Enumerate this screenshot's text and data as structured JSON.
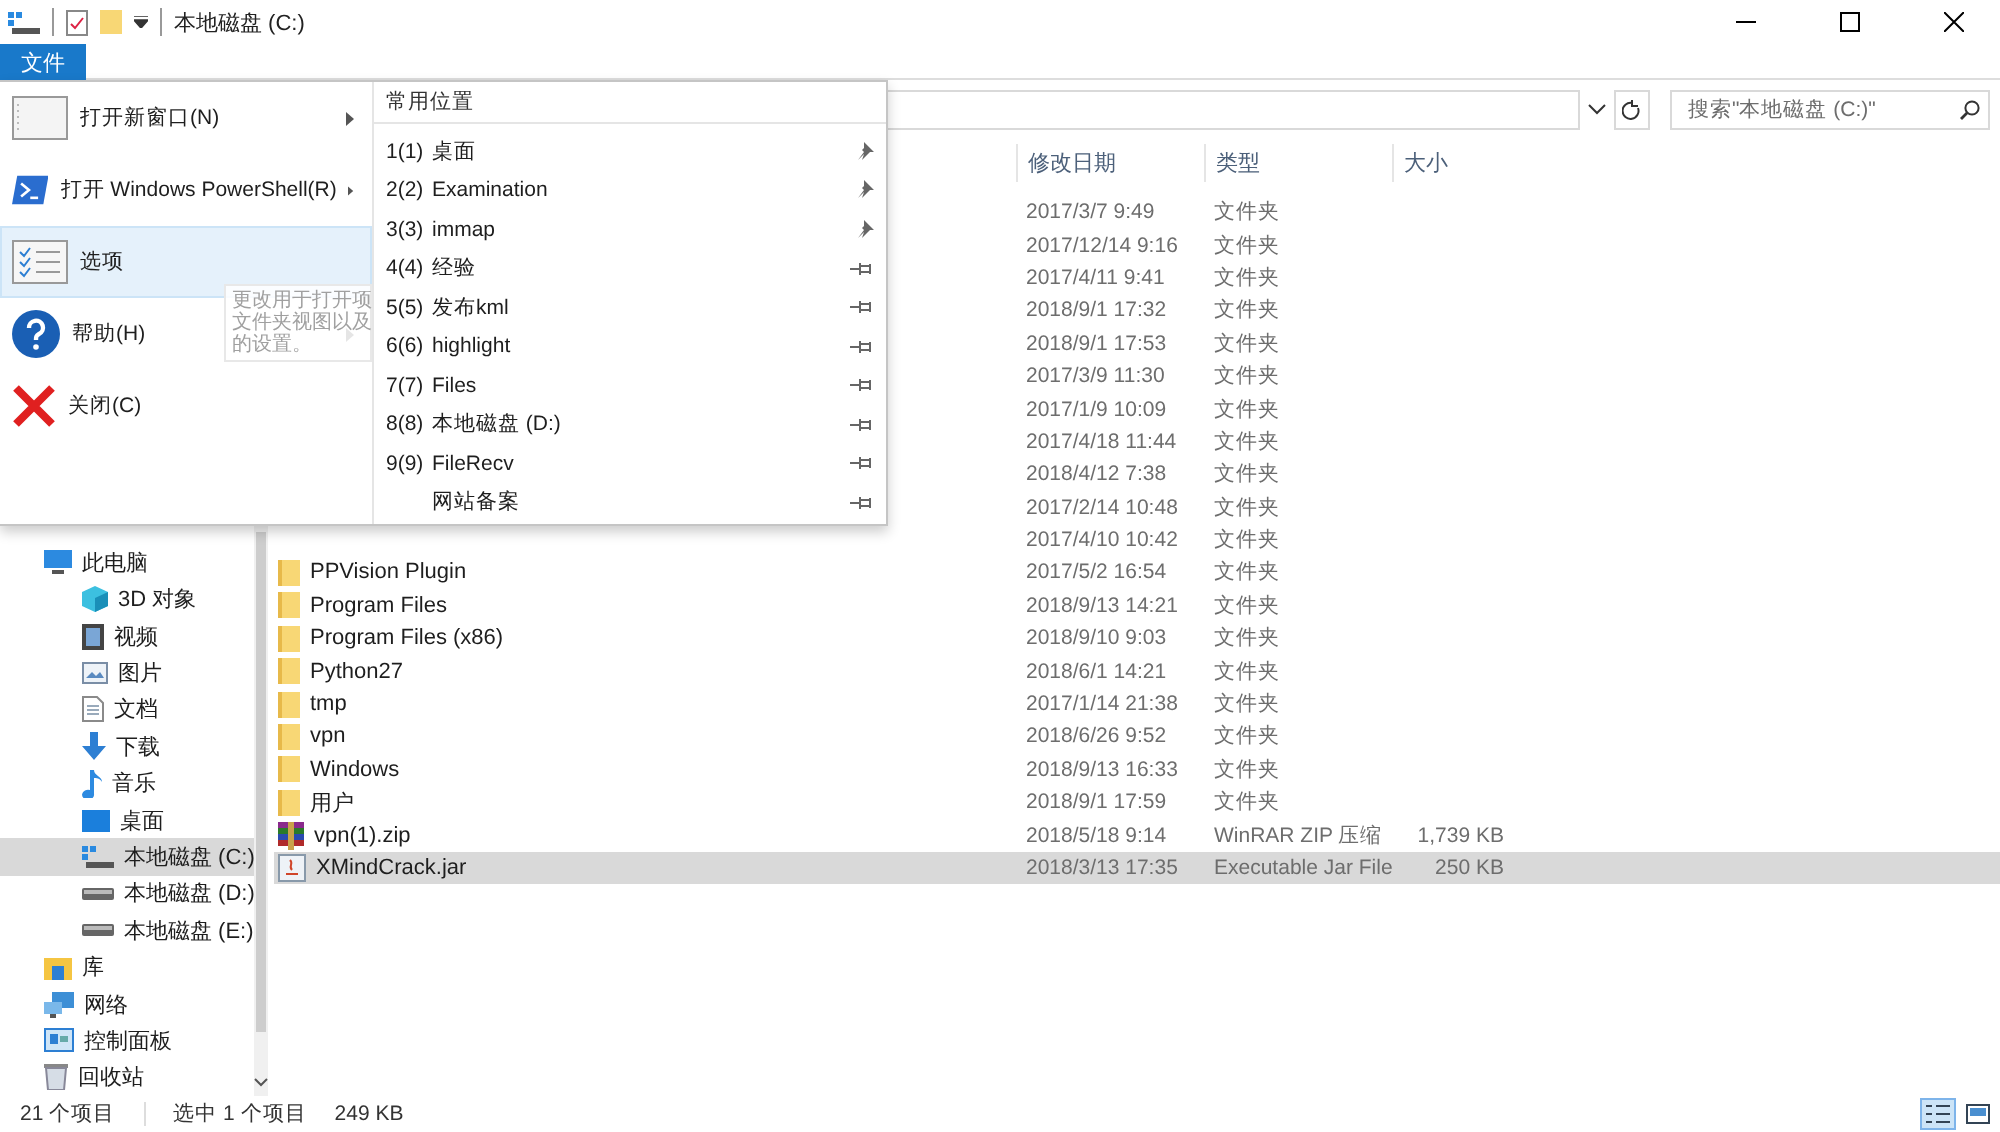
{
  "window": {
    "title": "本地磁盘 (C:)"
  },
  "file_tab": {
    "label": "文件",
    "selected": true
  },
  "file_menu": {
    "commands": [
      {
        "kind": "new-window",
        "label": "打开新窗口(N)",
        "has_submenu": true,
        "selected": false
      },
      {
        "kind": "powershell",
        "label": "打开 Windows PowerShell(R)",
        "has_submenu": true,
        "selected": false
      },
      {
        "kind": "options",
        "label": "选项",
        "has_submenu": false,
        "selected": true
      },
      {
        "kind": "help",
        "label": "帮助(H)",
        "has_submenu": true,
        "selected": false
      },
      {
        "kind": "close",
        "label": "关闭(C)",
        "has_submenu": false,
        "selected": false
      }
    ],
    "tooltip": {
      "lines": [
        "更改用于打开项",
        "文件夹视图以及",
        "的设置。"
      ]
    },
    "frequent_places": {
      "title": "常用位置",
      "items": [
        {
          "number": "1(1)",
          "name": "桌面",
          "pinned": true
        },
        {
          "number": "2(2)",
          "name": "Examination",
          "pinned": true
        },
        {
          "number": "3(3)",
          "name": "immap",
          "pinned": true
        },
        {
          "number": "4(4)",
          "name": "经验",
          "pinned": false
        },
        {
          "number": "5(5)",
          "name": "发布kml",
          "pinned": false
        },
        {
          "number": "6(6)",
          "name": "highlight",
          "pinned": false
        },
        {
          "number": "7(7)",
          "name": "Files",
          "pinned": false
        },
        {
          "number": "8(8)",
          "name": "本地磁盘 (D:)",
          "pinned": false
        },
        {
          "number": "9(9)",
          "name": "FileRecv",
          "pinned": false
        },
        {
          "name": "网站备案",
          "pinned": false
        }
      ]
    }
  },
  "search": {
    "placeholder": "搜索\"本地磁盘 (C:)\""
  },
  "navigation": [
    {
      "kind": "computer",
      "label": "此电脑",
      "selected": false,
      "children": [
        {
          "kind": "objects",
          "label": "3D 对象",
          "selected": false
        },
        {
          "kind": "video",
          "label": "视频",
          "selected": false
        },
        {
          "kind": "pictures",
          "label": "图片",
          "selected": false
        },
        {
          "kind": "documents",
          "label": "文档",
          "selected": false
        },
        {
          "kind": "downloads",
          "label": "下载",
          "selected": false
        },
        {
          "kind": "music",
          "label": "音乐",
          "selected": false
        },
        {
          "kind": "desktop",
          "label": "桌面",
          "selected": false
        },
        {
          "kind": "system-drive",
          "label": "本地磁盘 (C:)",
          "selected": true
        },
        {
          "kind": "drive",
          "label": "本地磁盘 (D:)",
          "selected": false
        },
        {
          "kind": "drive",
          "label": "本地磁盘 (E:)",
          "selected": false
        }
      ]
    },
    {
      "kind": "library",
      "label": "库",
      "selected": false
    },
    {
      "kind": "network",
      "label": "网络",
      "selected": false
    },
    {
      "kind": "control-panel",
      "label": "控制面板",
      "selected": false
    },
    {
      "kind": "recycle-bin",
      "label": "回收站",
      "selected": false
    }
  ],
  "files": {
    "columns": [
      "修改日期",
      "类型",
      "大小"
    ],
    "rows": [
      {
        "date": "2017/3/7 9:49",
        "type": "文件夹",
        "selected": false
      },
      {
        "date": "2017/12/14 9:16",
        "type": "文件夹",
        "selected": false
      },
      {
        "date": "2017/4/11 9:41",
        "type": "文件夹",
        "selected": false
      },
      {
        "date": "2018/9/1 17:32",
        "type": "文件夹",
        "selected": false
      },
      {
        "date": "2018/9/1 17:53",
        "type": "文件夹",
        "selected": false
      },
      {
        "date": "2017/3/9 11:30",
        "type": "文件夹",
        "selected": false
      },
      {
        "date": "2017/1/9 10:09",
        "type": "文件夹",
        "selected": false
      },
      {
        "date": "2017/4/18 11:44",
        "type": "文件夹",
        "selected": false
      },
      {
        "date": "2018/4/12 7:38",
        "type": "文件夹",
        "selected": false
      },
      {
        "date": "2017/2/14 10:48",
        "type": "文件夹",
        "selected": false
      },
      {
        "date": "2017/4/10 10:42",
        "type": "文件夹",
        "selected": false
      },
      {
        "kind": "folder",
        "name": "PPVision Plugin",
        "date": "2017/5/2 16:54",
        "type": "文件夹",
        "selected": false
      },
      {
        "kind": "folder",
        "name": "Program Files",
        "date": "2018/9/13 14:21",
        "type": "文件夹",
        "selected": false
      },
      {
        "kind": "folder",
        "name": "Program Files (x86)",
        "date": "2018/9/10 9:03",
        "type": "文件夹",
        "selected": false
      },
      {
        "kind": "folder",
        "name": "Python27",
        "date": "2018/6/1 14:21",
        "type": "文件夹",
        "selected": false
      },
      {
        "kind": "folder",
        "name": "tmp",
        "date": "2017/1/14 21:38",
        "type": "文件夹",
        "selected": false
      },
      {
        "kind": "folder",
        "name": "vpn",
        "date": "2018/6/26 9:52",
        "type": "文件夹",
        "selected": false
      },
      {
        "kind": "folder",
        "name": "Windows",
        "date": "2018/9/13 16:33",
        "type": "文件夹",
        "selected": false
      },
      {
        "kind": "folder",
        "name": "用户",
        "date": "2018/9/1 17:59",
        "type": "文件夹",
        "selected": false
      },
      {
        "kind": "zip",
        "name": "vpn(1).zip",
        "date": "2018/5/18 9:14",
        "type": "WinRAR ZIP 压缩",
        "size": "1,739 KB",
        "selected": false
      },
      {
        "kind": "jar",
        "name": "XMindCrack.jar",
        "date": "2018/3/13 17:35",
        "type": "Executable Jar File",
        "size": "250 KB",
        "selected": true
      }
    ]
  },
  "status_bar": {
    "item_count": "21 个项目",
    "selection": "选中 1 个项目",
    "selection_size": "249 KB"
  },
  "view_buttons": [
    {
      "kind": "details",
      "selected": true
    },
    {
      "kind": "large-icons",
      "selected": false
    }
  ]
}
